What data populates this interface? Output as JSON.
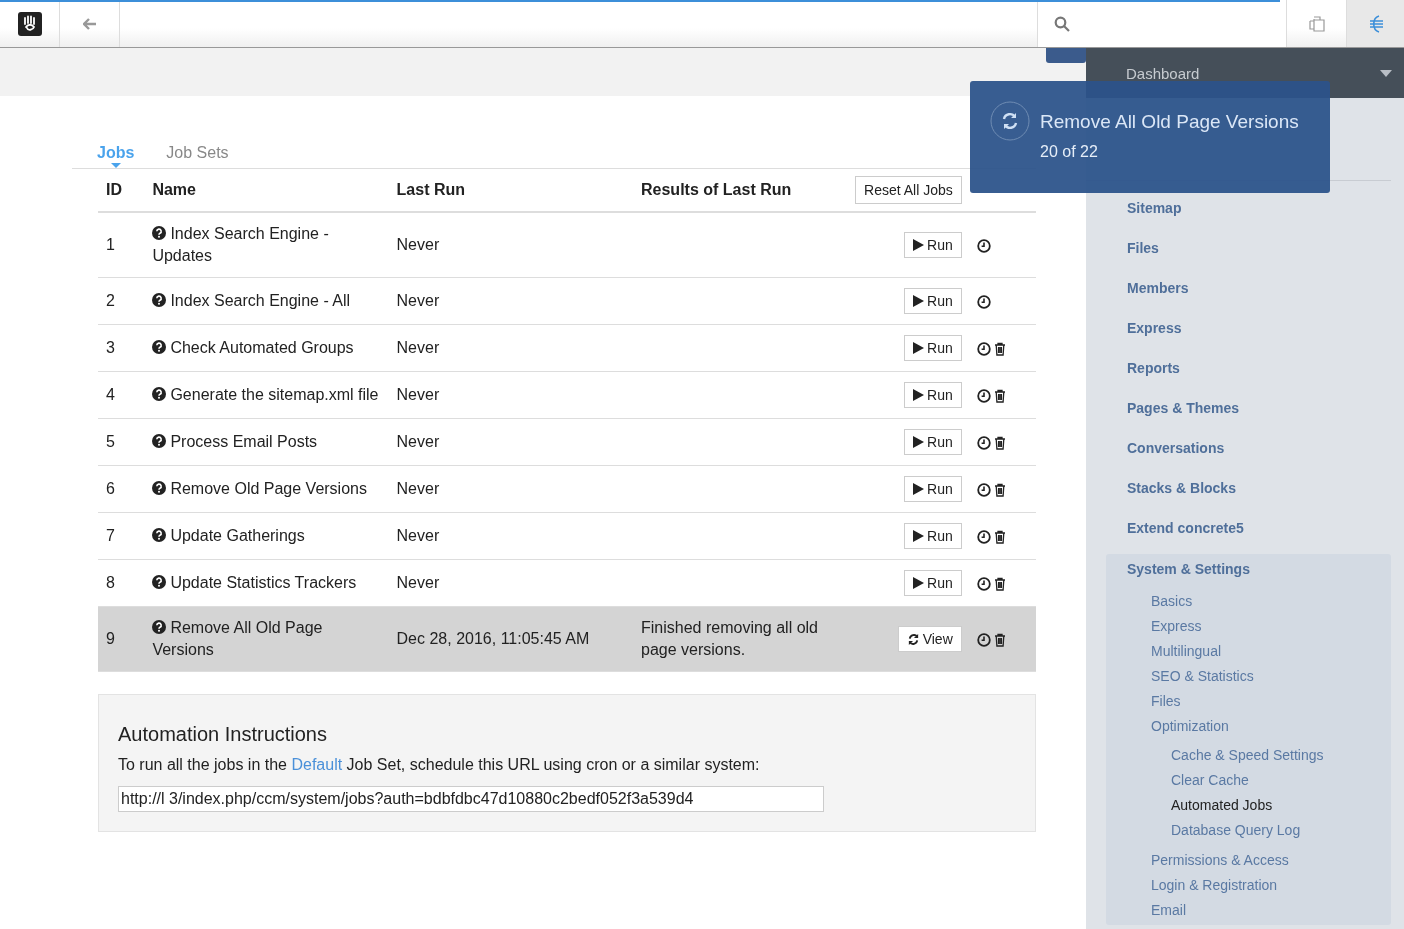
{
  "tabs": [
    {
      "label": "Jobs",
      "selected": true
    },
    {
      "label": "Job Sets",
      "selected": false
    }
  ],
  "table": {
    "columns": [
      "ID",
      "Name",
      "Last Run",
      "Results of Last Run"
    ],
    "reset_button": "Reset All Jobs",
    "rows": [
      {
        "id": "1",
        "name": "Index Search Engine - Updates",
        "last_run": "Never",
        "button": {
          "kind": "run",
          "label": "Run"
        },
        "deletable": false,
        "selected": false
      },
      {
        "id": "2",
        "name": "Index Search Engine - All",
        "last_run": "Never",
        "button": {
          "kind": "run",
          "label": "Run"
        },
        "deletable": false,
        "selected": false
      },
      {
        "id": "3",
        "name": "Check Automated Groups",
        "last_run": "Never",
        "button": {
          "kind": "run",
          "label": "Run"
        },
        "deletable": true,
        "selected": false
      },
      {
        "id": "4",
        "name": "Generate the sitemap.xml file",
        "last_run": "Never",
        "button": {
          "kind": "run",
          "label": "Run"
        },
        "deletable": true,
        "selected": false
      },
      {
        "id": "5",
        "name": "Process Email Posts",
        "last_run": "Never",
        "button": {
          "kind": "run",
          "label": "Run"
        },
        "deletable": true,
        "selected": false
      },
      {
        "id": "6",
        "name": "Remove Old Page Versions",
        "last_run": "Never",
        "button": {
          "kind": "run",
          "label": "Run"
        },
        "deletable": true,
        "selected": false
      },
      {
        "id": "7",
        "name": "Update Gatherings",
        "last_run": "Never",
        "button": {
          "kind": "run",
          "label": "Run"
        },
        "deletable": true,
        "selected": false
      },
      {
        "id": "8",
        "name": "Update Statistics Trackers",
        "last_run": "Never",
        "button": {
          "kind": "run",
          "label": "Run"
        },
        "deletable": true,
        "selected": false
      },
      {
        "id": "9",
        "name": "Remove All Old Page Versions",
        "last_run": "Dec 28, 2016, 11:05:45 AM",
        "result": "Finished removing all old page versions.",
        "button": {
          "kind": "view",
          "label": "View"
        },
        "deletable": true,
        "selected": true
      }
    ]
  },
  "instructions": {
    "title": "Automation Instructions",
    "text_before": "To run all the jobs in the",
    "link": "Default",
    "text_after": "Job Set, schedule this URL using cron or a similar system:",
    "url": "http://l 3/index.php/ccm/system/jobs?auth=bdbfdbc47d10880c2bedf052f3a539d4"
  },
  "progress": {
    "title": "Remove All Old Page Versions",
    "count": "20 of 22"
  },
  "sidebar": {
    "header": "Dashboard",
    "items": [
      {
        "label": "Sitemap",
        "selected": false
      },
      {
        "label": "Files",
        "selected": false
      },
      {
        "label": "Members",
        "selected": false
      },
      {
        "label": "Express",
        "selected": false
      },
      {
        "label": "Reports",
        "selected": false
      },
      {
        "label": "Pages & Themes",
        "selected": false
      },
      {
        "label": "Conversations",
        "selected": false
      },
      {
        "label": "Stacks & Blocks",
        "selected": false
      },
      {
        "label": "Extend concrete5",
        "selected": false
      },
      {
        "label": "System & Settings",
        "selected": false,
        "children": [
          {
            "label": "Basics",
            "selected": false
          },
          {
            "label": "Express",
            "selected": false
          },
          {
            "label": "Multilingual",
            "selected": false
          },
          {
            "label": "SEO & Statistics",
            "selected": false
          },
          {
            "label": "Files",
            "selected": false
          },
          {
            "label": "Optimization",
            "selected": false,
            "children": [
              {
                "label": "Cache & Speed Settings",
                "selected": false
              },
              {
                "label": "Clear Cache",
                "selected": false
              },
              {
                "label": "Automated Jobs",
                "selected": true
              },
              {
                "label": "Database Query Log",
                "selected": false
              }
            ]
          },
          {
            "label": "Permissions & Access",
            "selected": false
          },
          {
            "label": "Login & Registration",
            "selected": false
          },
          {
            "label": "Email",
            "selected": false
          }
        ]
      }
    ]
  }
}
